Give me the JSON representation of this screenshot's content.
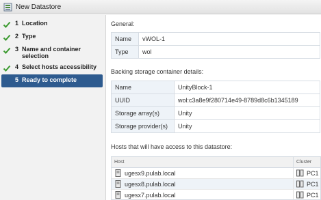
{
  "window": {
    "title": "New Datastore"
  },
  "steps": [
    {
      "num": "1",
      "label": "Location",
      "done": true
    },
    {
      "num": "2",
      "label": "Type",
      "done": true
    },
    {
      "num": "3",
      "label": "Name and container selection",
      "done": true
    },
    {
      "num": "4",
      "label": "Select hosts accessibility",
      "done": true
    },
    {
      "num": "5",
      "label": "Ready to complete",
      "active": true
    }
  ],
  "general": {
    "title": "General:",
    "rows": [
      {
        "key": "Name",
        "value": "vWOL-1"
      },
      {
        "key": "Type",
        "value": "wol"
      }
    ]
  },
  "backing": {
    "title": "Backing storage container details:",
    "rows": [
      {
        "key": "Name",
        "value": "UnityBlock-1"
      },
      {
        "key": "UUID",
        "value": "wol:c3a8e9f280714e49-8789d8c6b1345189"
      },
      {
        "key": "Storage array(s)",
        "value": "Unity"
      },
      {
        "key": "Storage provider(s)",
        "value": "Unity"
      }
    ]
  },
  "hosts": {
    "title": "Hosts that will have access to this datastore:",
    "columns": {
      "host": "Host",
      "cluster": "Cluster"
    },
    "rows": [
      {
        "host": "ugesx9.pulab.local",
        "cluster": "PC1"
      },
      {
        "host": "ugesx8.pulab.local",
        "cluster": "PC1"
      },
      {
        "host": "ugesx7.pulab.local",
        "cluster": "PC1"
      }
    ]
  },
  "colors": {
    "accent": "#2e5b8f",
    "check": "#3a9a2e",
    "key_bg": "#eef3f8"
  },
  "icons": {
    "title": "datastore-icon",
    "step_done": "check-icon",
    "host": "host-icon",
    "cluster": "cluster-icon"
  }
}
